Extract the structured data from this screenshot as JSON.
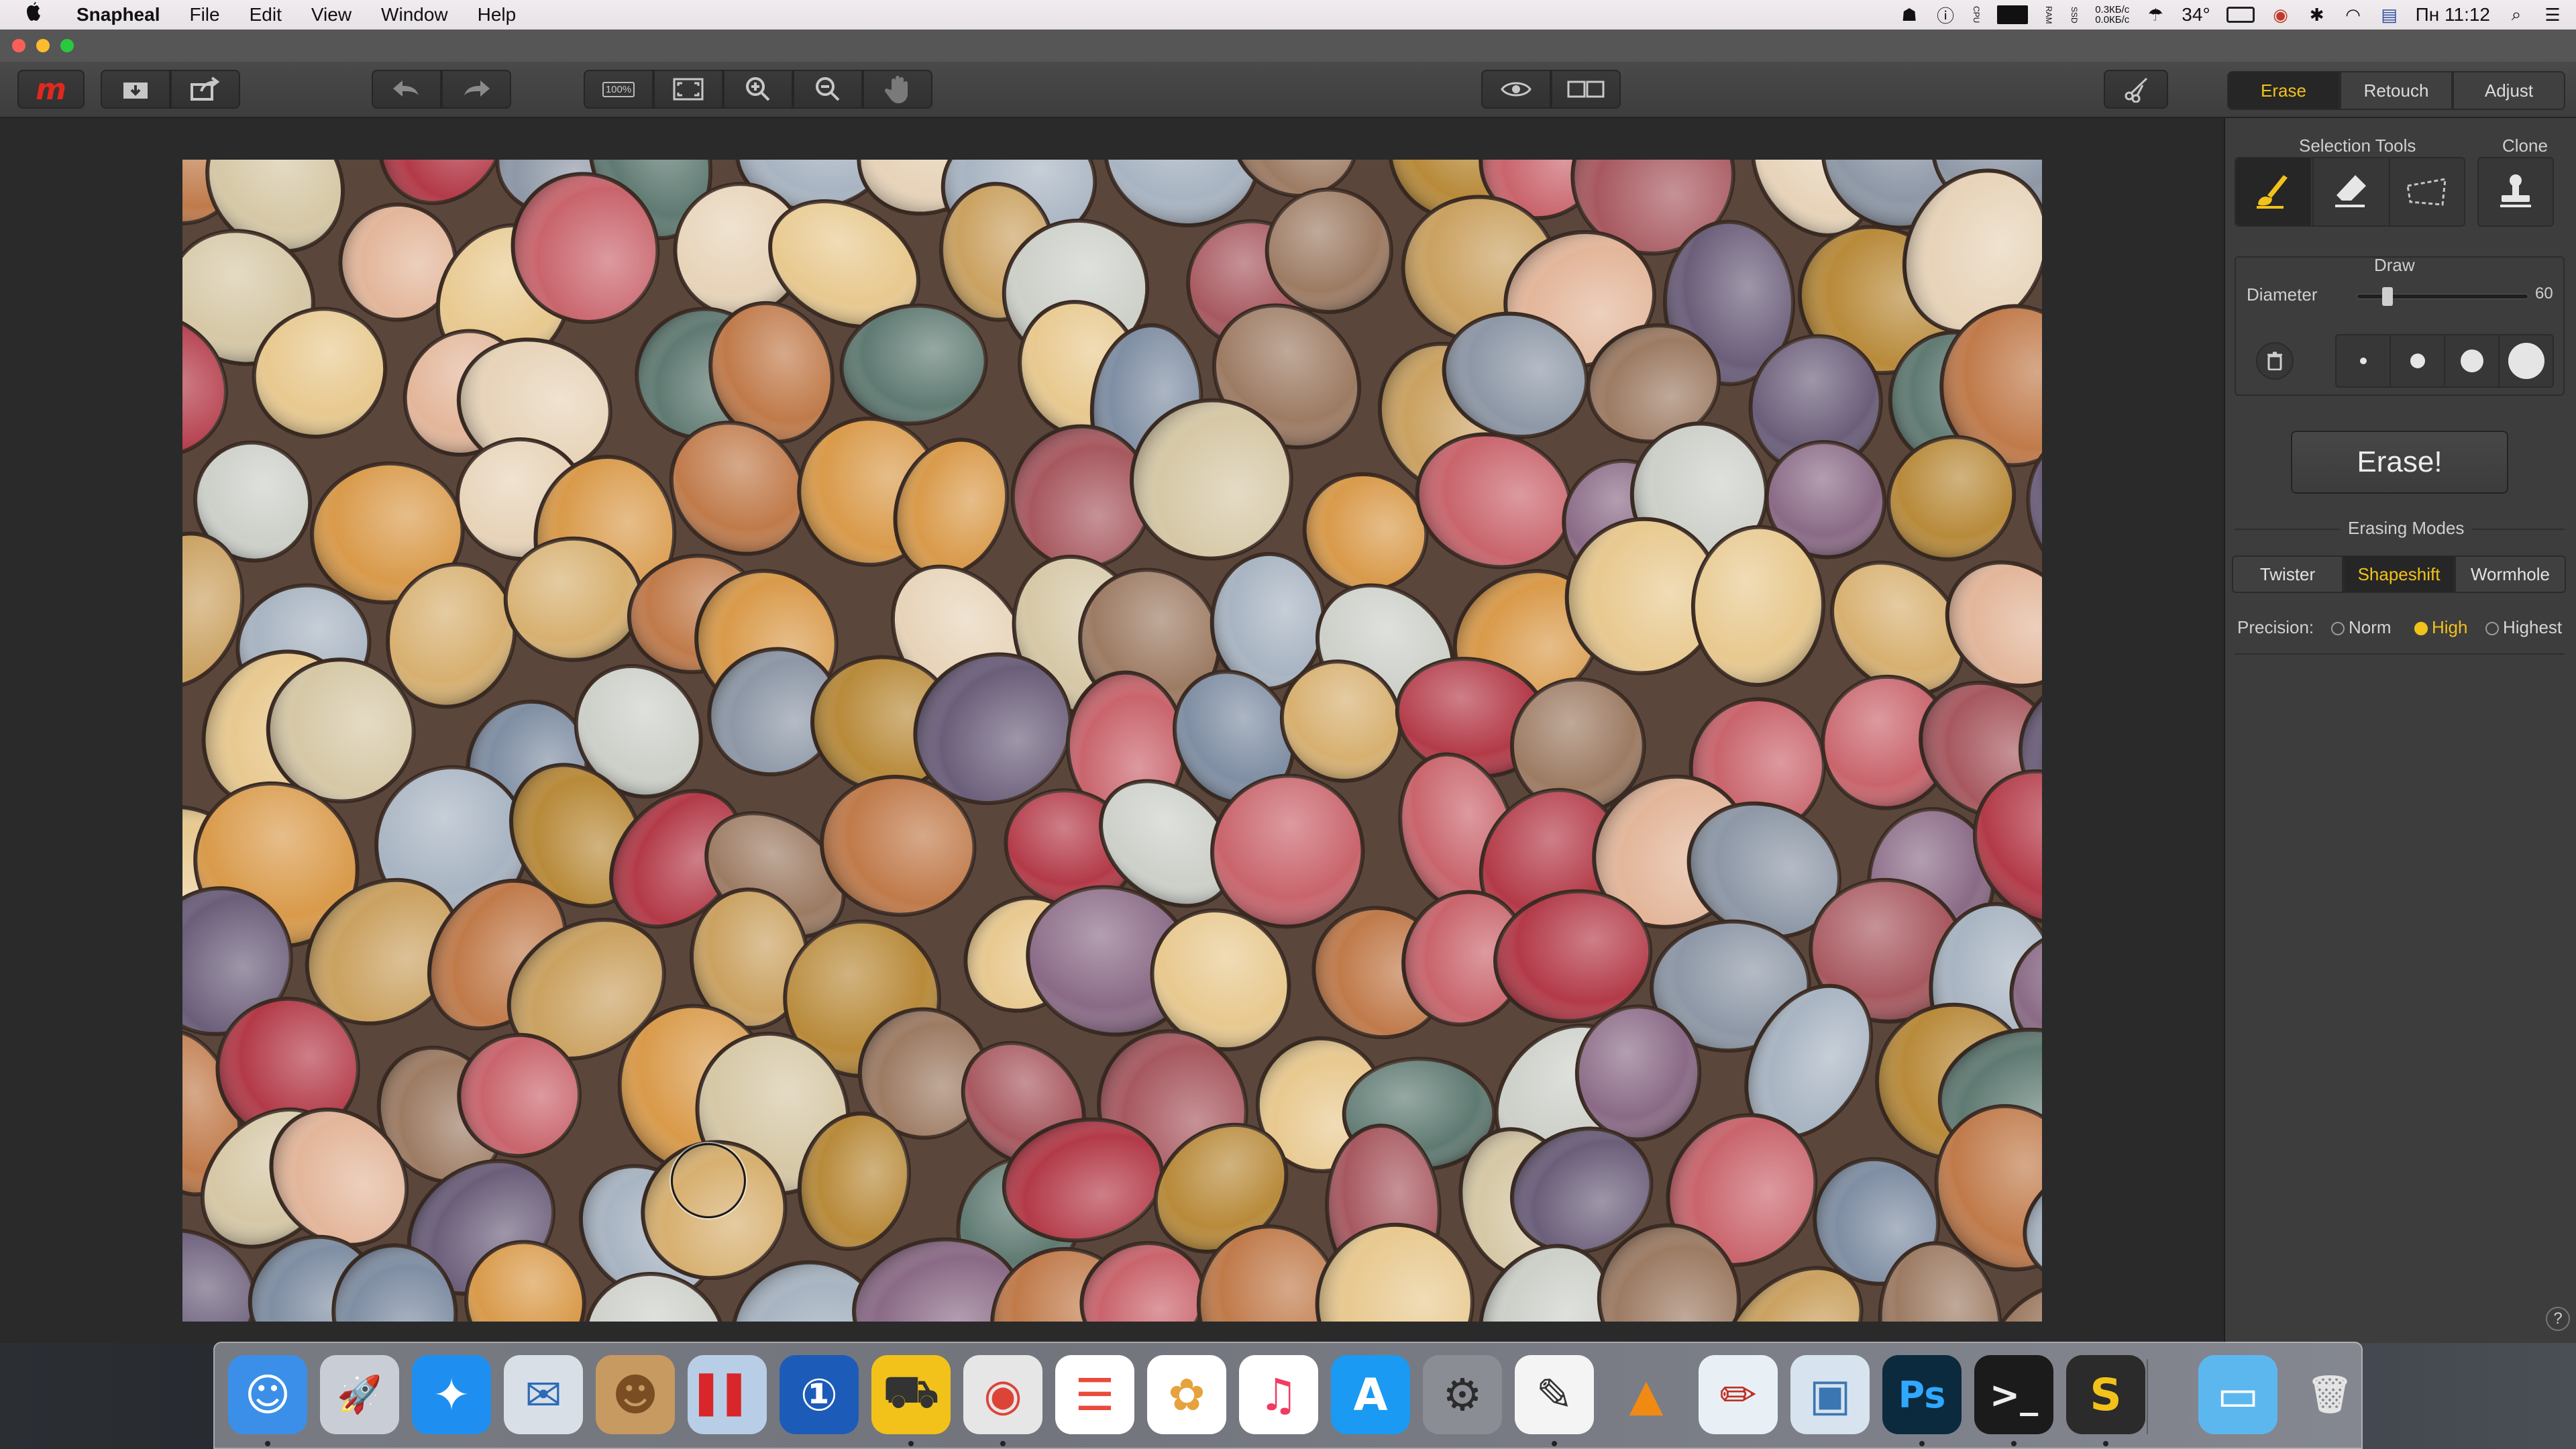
{
  "menubar": {
    "app_name": "Snapheal",
    "menus": [
      "File",
      "Edit",
      "View",
      "Window",
      "Help"
    ],
    "status": {
      "net_up": "0.3КБ/с",
      "net_down": "0.0КБ/с",
      "temperature": "34°",
      "clock": "Пн 11:12"
    }
  },
  "toolbar": {
    "zoom_100_label": "100%",
    "tabs": [
      {
        "label": "Erase",
        "active": true
      },
      {
        "label": "Retouch",
        "active": false
      },
      {
        "label": "Adjust",
        "active": false
      }
    ]
  },
  "panel": {
    "selection_tools_label": "Selection Tools",
    "clone_label": "Clone",
    "draw_label": "Draw",
    "diameter_label": "Diameter",
    "diameter_value": "60",
    "erase_button": "Erase!",
    "erasing_modes_label": "Erasing Modes",
    "modes": [
      {
        "label": "Twister",
        "active": false
      },
      {
        "label": "Shapeshift",
        "active": true
      },
      {
        "label": "Wormhole",
        "active": false
      }
    ],
    "precision_label": "Precision:",
    "precision_options": [
      {
        "label": "Norm",
        "selected": false
      },
      {
        "label": "High",
        "selected": true
      },
      {
        "label": "Highest",
        "selected": false
      }
    ],
    "help_label": "?"
  },
  "icons": {
    "apple": "apple-icon",
    "logo": "snapheal-logo",
    "import": "import-icon",
    "share": "share-icon",
    "undo": "undo-icon",
    "redo": "redo-icon",
    "fit": "fit-screen-icon",
    "zoom_in": "zoom-in-icon",
    "zoom_out": "zoom-out-icon",
    "hand": "hand-icon",
    "eye": "eye-icon",
    "compare": "compare-icon",
    "scissors": "crop-scissors-icon"
  },
  "colors": {
    "accent": "#f2c21b",
    "brand": "#e0281f",
    "panel_bg": "#3d3d3d",
    "canvas_bg": "#2a2a2a"
  },
  "dock": {
    "apps": [
      {
        "name": "finder",
        "glyph": "☺",
        "bg": "#3b8fe8",
        "fg": "#ffffff"
      },
      {
        "name": "launchpad",
        "glyph": "🚀",
        "bg": "#c9ced6",
        "fg": "#333333"
      },
      {
        "name": "safari",
        "glyph": "✦",
        "bg": "#1e8ff0",
        "fg": "#ffffff"
      },
      {
        "name": "mail",
        "glyph": "✉",
        "bg": "#d9dfe7",
        "fg": "#2a6bb8"
      },
      {
        "name": "contacts",
        "glyph": "☻",
        "bg": "#c79a62",
        "fg": "#7a4e22"
      },
      {
        "name": "parallels",
        "glyph": "▌▌",
        "bg": "#b8cee6",
        "fg": "#d9262a"
      },
      {
        "name": "1password",
        "glyph": "①",
        "bg": "#1c5cb8",
        "fg": "#ffffff"
      },
      {
        "name": "transmit",
        "glyph": "⛟",
        "bg": "#f2c21b",
        "fg": "#333333"
      },
      {
        "name": "chrome",
        "glyph": "◉",
        "bg": "#e6e6e6",
        "fg": "#db4437"
      },
      {
        "name": "reminders",
        "glyph": "☰",
        "bg": "#ffffff",
        "fg": "#e84b3c"
      },
      {
        "name": "photos",
        "glyph": "✿",
        "bg": "#ffffff",
        "fg": "#e6a23c"
      },
      {
        "name": "itunes",
        "glyph": "♫",
        "bg": "#ffffff",
        "fg": "#f13b62"
      },
      {
        "name": "app-store",
        "glyph": "A",
        "bg": "#1a9af2",
        "fg": "#ffffff"
      },
      {
        "name": "system-preferences",
        "glyph": "⚙",
        "bg": "#8a8e94",
        "fg": "#2b2b2b"
      },
      {
        "name": "textedit",
        "glyph": "✎",
        "bg": "#f4f4f4",
        "fg": "#333333"
      },
      {
        "name": "vlc",
        "glyph": "▲",
        "bg": "transparent",
        "fg": "#f08a13"
      },
      {
        "name": "sketchbook",
        "glyph": "✏",
        "bg": "#e8f0f6",
        "fg": "#c03024"
      },
      {
        "name": "preview",
        "glyph": "▣",
        "bg": "#d7e3ee",
        "fg": "#3b76b3"
      },
      {
        "name": "photoshop",
        "glyph": "Ps",
        "bg": "#0b2a3e",
        "fg": "#30a8ff"
      },
      {
        "name": "terminal",
        "glyph": ">_",
        "bg": "#1b1b1b",
        "fg": "#eeeeee"
      },
      {
        "name": "sublime",
        "glyph": "S",
        "bg": "#2b2b2b",
        "fg": "#f2c21b"
      },
      {
        "name": "downloads-folder",
        "glyph": "▭",
        "bg": "#5db7ef",
        "fg": "#ffffff"
      },
      {
        "name": "trash",
        "glyph": "🗑",
        "bg": "transparent",
        "fg": "#e4e4e4"
      }
    ]
  }
}
